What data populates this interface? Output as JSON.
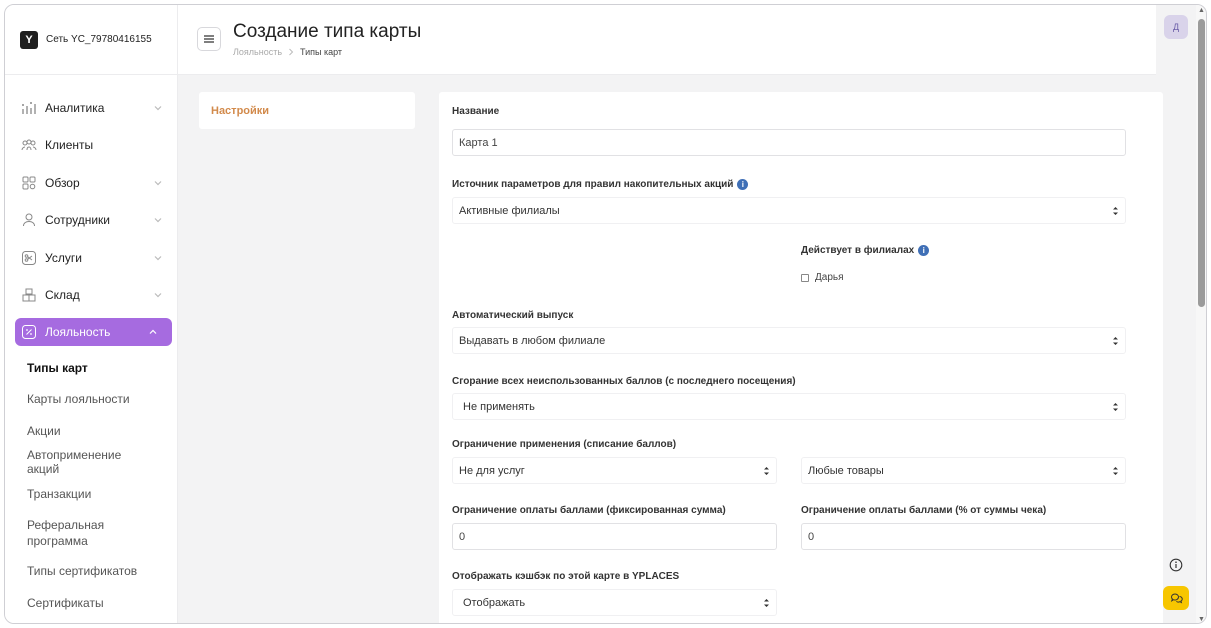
{
  "brand": {
    "name": "Сеть YC_79780416155"
  },
  "header": {
    "title": "Создание типа карты",
    "breadcrumb": [
      "Лояльность",
      "Типы карт"
    ]
  },
  "user": {
    "avatar_letter": "Д"
  },
  "sidebar": {
    "items": [
      {
        "label": "Аналитика",
        "icon": "analytics-icon",
        "has_chevron": true
      },
      {
        "label": "Клиенты",
        "icon": "clients-icon",
        "has_chevron": false
      },
      {
        "label": "Обзор",
        "icon": "grid-icon",
        "has_chevron": true
      },
      {
        "label": "Сотрудники",
        "icon": "person-icon",
        "has_chevron": true
      },
      {
        "label": "Услуги",
        "icon": "scissors-icon",
        "has_chevron": true
      },
      {
        "label": "Склад",
        "icon": "boxes-icon",
        "has_chevron": true
      },
      {
        "label": "Лояльность",
        "icon": "loyalty-icon",
        "has_chevron": true,
        "active": true
      }
    ],
    "submenu": [
      {
        "label": "Типы карт",
        "current": true
      },
      {
        "label": "Карты лояльности"
      },
      {
        "label": "Акции"
      },
      {
        "label": "Автоприменение акций"
      },
      {
        "label": "Транзакции"
      },
      {
        "label": "Реферальная программа"
      },
      {
        "label": "Типы сертификатов"
      },
      {
        "label": "Сертификаты"
      }
    ]
  },
  "tabs": {
    "settings": "Настройки"
  },
  "form": {
    "name_label": "Название",
    "name_value": "Карта 1",
    "source_label": "Источник параметров для правил накопительных акций",
    "source_value": "Активные филиалы",
    "branches_label": "Действует в филиалах",
    "branch_option": "Дарья",
    "auto_issue_label": "Автоматический выпуск",
    "auto_issue_value": "Выдавать в любом филиале",
    "burn_label": "Сгорание всех неиспользованных баллов (с последнего посещения)",
    "burn_value": "Не применять",
    "restriction_label": "Ограничение применения (списание баллов)",
    "restriction_value_1": "Не для услуг",
    "restriction_value_2": "Любые товары",
    "fixed_limit_label": "Ограничение оплаты баллами (фиксированная сумма)",
    "fixed_limit_value": "0",
    "percent_limit_label": "Ограничение оплаты баллами (% от суммы чека)",
    "percent_limit_value": "0",
    "cashback_label": "Отображать кэшбэк по этой карте в YPLACES",
    "cashback_value": "Отображать"
  },
  "colors": {
    "accent": "#a66be0",
    "tab_active": "#d28a4b",
    "info": "#3f6fb6",
    "chat": "#f7c600"
  }
}
